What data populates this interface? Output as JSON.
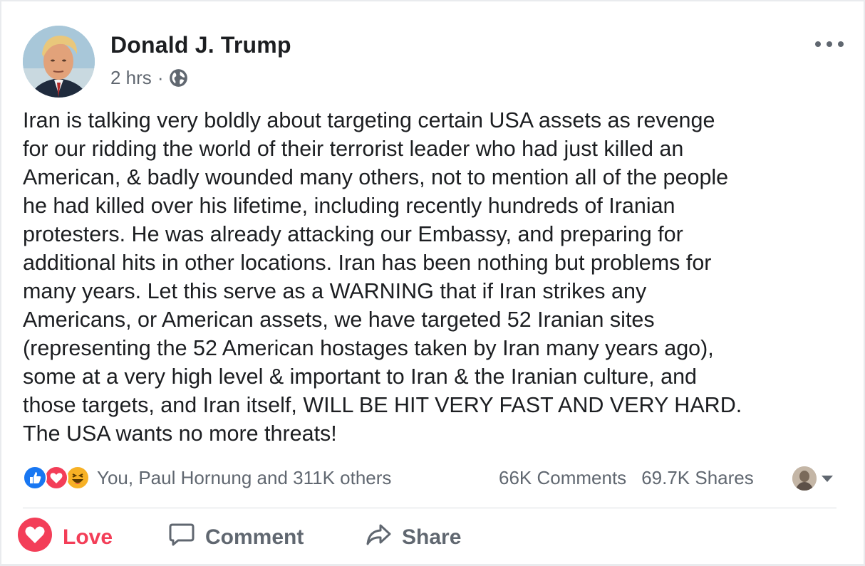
{
  "post": {
    "author": "Donald J. Trump",
    "time": "2 hrs",
    "separator": "·",
    "privacy_icon": "globe-icon",
    "more_icon": "more-options-icon",
    "text": "Iran is talking very boldly about targeting certain USA assets as revenge\nfor our ridding the world of their terrorist leader who had just killed an\nAmerican, & badly wounded many others, not to mention all of the people\nhe had killed over his lifetime, including recently hundreds of Iranian\nprotesters. He was already attacking our Embassy, and preparing for\nadditional hits in other locations. Iran has been nothing but problems for\nmany years. Let this serve as a WARNING that if Iran strikes any\nAmericans, or American assets, we have targeted 52 Iranian sites\n(representing the 52 American hostages taken by Iran many years ago),\nsome at a very high level & important to Iran &  the Iranian culture, and\nthose targets, and Iran itself, WILL BE HIT VERY FAST AND VERY HARD.\nThe USA wants no more threats!"
  },
  "reactions": {
    "icons": [
      "like-icon",
      "love-icon",
      "haha-icon"
    ],
    "summary": "You, Paul Hornung and 311K others",
    "comments": "66K Comments",
    "shares": "69.7K Shares"
  },
  "actions": {
    "love": "Love",
    "comment": "Comment",
    "share": "Share"
  },
  "colors": {
    "love": "#f33e58",
    "like": "#1877f2",
    "haha": "#f7b125",
    "secondary_text": "#606770"
  }
}
